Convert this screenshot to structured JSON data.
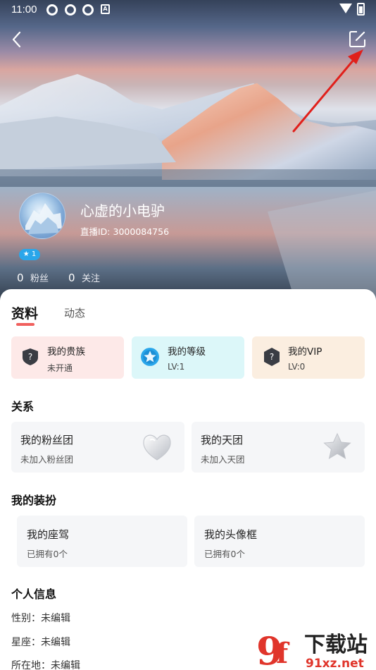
{
  "status_bar": {
    "time": "11:00",
    "badge_letter": "A"
  },
  "header": {
    "back_icon": "chevron-left-icon",
    "edit_icon": "edit-icon"
  },
  "profile": {
    "nickname": "心虚的小电驴",
    "live_id_label": "直播ID:",
    "live_id": "3000084756",
    "level_badge": "1",
    "fans_count": "0",
    "fans_label": "粉丝",
    "follow_count": "0",
    "follow_label": "关注"
  },
  "tabs": [
    {
      "label": "资料",
      "active": true
    },
    {
      "label": "动态",
      "active": false
    }
  ],
  "status_cards": [
    {
      "title": "我的贵族",
      "value": "未开通",
      "color": "#fde9e8"
    },
    {
      "title": "我的等级",
      "value": "LV:1",
      "color": "#dcf7f9"
    },
    {
      "title": "我的VIP",
      "value": "LV:0",
      "color": "#fbeee0"
    }
  ],
  "relations": {
    "title": "关系",
    "items": [
      {
        "title": "我的粉丝团",
        "sub": "未加入粉丝团"
      },
      {
        "title": "我的天团",
        "sub": "未加入天团"
      }
    ]
  },
  "dressup": {
    "title": "我的装扮",
    "items": [
      {
        "title": "我的座驾",
        "sub": "已拥有0个"
      },
      {
        "title": "我的头像框",
        "sub": "已拥有0个"
      }
    ]
  },
  "personal": {
    "title": "个人信息",
    "rows": [
      {
        "label": "性别：",
        "value": "未编辑"
      },
      {
        "label": "星座：",
        "value": "未编辑"
      },
      {
        "label": "所在地：",
        "value": "未编辑"
      }
    ]
  },
  "watermark": {
    "text": "下载站",
    "url_text": "91xz.net"
  },
  "colors": {
    "accent": "#f0605d",
    "level_blue": "#2aa6ea",
    "annotation_red": "#e0201b"
  }
}
